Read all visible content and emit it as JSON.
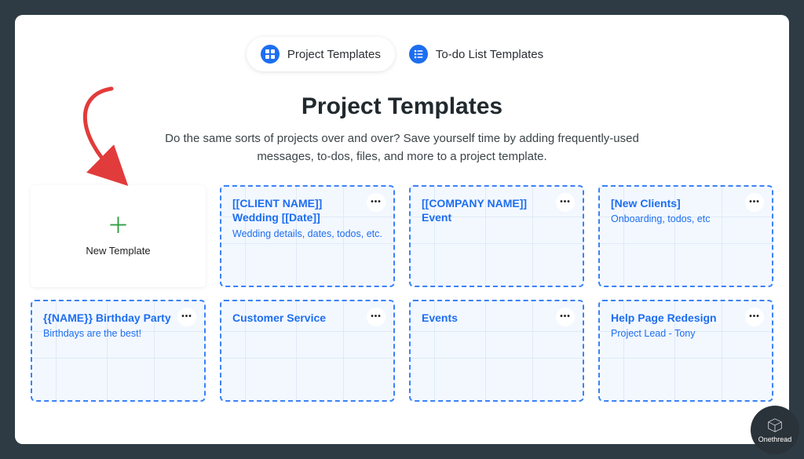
{
  "tabs": {
    "project_templates": "Project Templates",
    "todo_templates": "To-do List Templates"
  },
  "heading": "Project Templates",
  "subtitle": "Do the same sorts of projects over and over? Save yourself time by adding frequently-used messages, to-dos, files, and more to a project template.",
  "new_template_label": "New Template",
  "cards": [
    {
      "title": "[[CLIENT NAME]] Wedding [[Date]]",
      "subtitle": "Wedding details, dates, todos, etc."
    },
    {
      "title": "[[COMPANY NAME]] Event",
      "subtitle": ""
    },
    {
      "title": "[New Clients]",
      "subtitle": "Onboarding, todos, etc"
    },
    {
      "title": "{{NAME}} Birthday Party",
      "subtitle": "Birthdays are the best!"
    },
    {
      "title": "Customer Service",
      "subtitle": ""
    },
    {
      "title": "Events",
      "subtitle": ""
    },
    {
      "title": "Help Page Redesign",
      "subtitle": "Project Lead - Tony"
    }
  ],
  "brand": "Onethread"
}
